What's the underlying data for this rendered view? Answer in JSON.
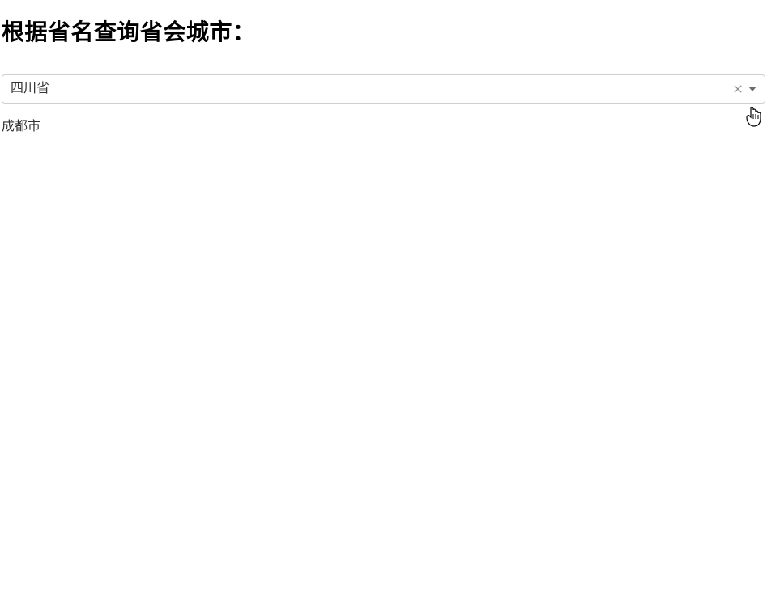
{
  "heading": "根据省名查询省会城市：",
  "select": {
    "value": "四川省"
  },
  "result": "成都市"
}
